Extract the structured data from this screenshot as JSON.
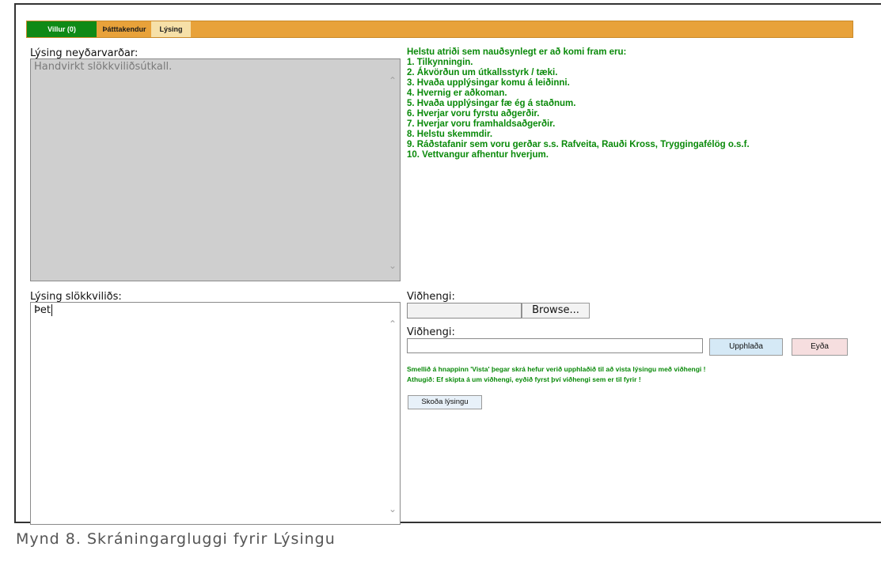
{
  "tabs": [
    {
      "label": "Villur (0)",
      "active": false
    },
    {
      "label": "Þátttakendur",
      "active": false
    },
    {
      "label": "Lýsing",
      "active": true
    }
  ],
  "emergency": {
    "label": "Lýsing neyðarvarðar:",
    "value": "Handvirkt slökkviliðsútkall."
  },
  "info": {
    "heading": "Helstu atriði sem nauðsynlegt er að komi fram eru:",
    "items": [
      "1. Tilkynningin.",
      "2. Ákvörðun um útkallsstyrk / tæki.",
      "3. Hvaða upplýsingar komu á leiðinni.",
      "4. Hvernig er aðkoman.",
      "5. Hvaða upplýsingar fæ ég á staðnum.",
      "6. Hverjar voru fyrstu aðgerðir.",
      "7. Hverjar voru framhaldsaðgerðir.",
      "8. Helstu skemmdir.",
      "9. Ráðstafanir sem voru gerðar s.s. Rafveita, Rauði Kross, Tryggingafélög o.s.f.",
      "10. Vettvangur afhentur hverjum."
    ]
  },
  "fire": {
    "label": "Lýsing slökkviliðs:",
    "value": "Þet"
  },
  "attachment1": {
    "label": "Viðhengi:",
    "browse_label": "Browse..."
  },
  "attachment2": {
    "label": "Viðhengi:",
    "value": "",
    "upload_label": "Upphlaða",
    "delete_label": "Eyða"
  },
  "notes": [
    "Smellið á hnappinn 'Vista' þegar skrá hefur verið upphlaðið til að vista lýsingu með viðhengi !",
    "Athugið: Ef skipta á um viðhengi, eyðið fyrst því viðhengi sem er til fyrir !"
  ],
  "view_button": "Skoða lýsingu",
  "caption": "Mynd 8. Skráningargluggi fyrir Lýsingu",
  "colors": {
    "tabbar": "#e8a23a",
    "active_tab": "#0f8a16",
    "info_text": "#0a8a0a"
  }
}
